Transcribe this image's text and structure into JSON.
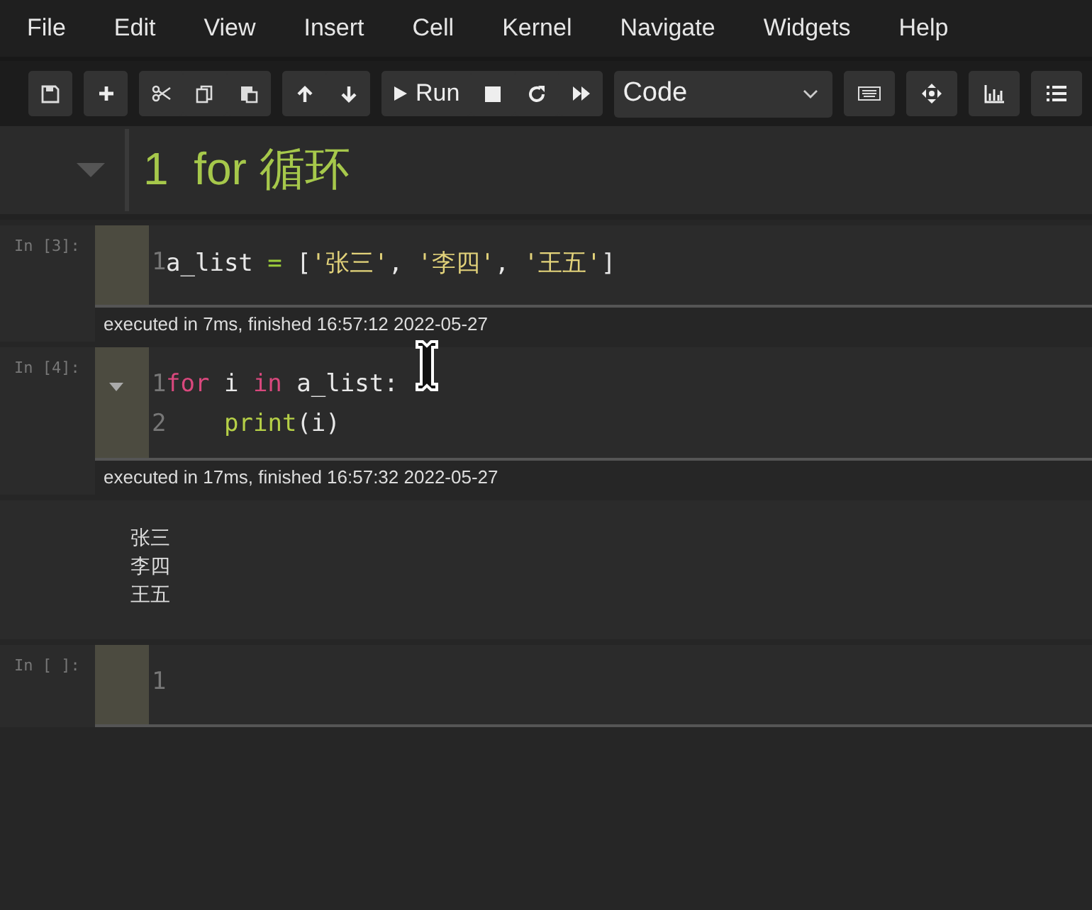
{
  "menu": [
    "File",
    "Edit",
    "View",
    "Insert",
    "Cell",
    "Kernel",
    "Navigate",
    "Widgets",
    "Help"
  ],
  "toolbar": {
    "run_label": "Run",
    "cell_type": "Code"
  },
  "heading": {
    "number": "1",
    "text": "for 循环",
    "expanded": true
  },
  "cells": [
    {
      "prompt": "In [3]:",
      "collapsible": false,
      "lines": [
        {
          "number": "1",
          "indented": false,
          "tokens": [
            {
              "kind": "name",
              "text": "a_list "
            },
            {
              "kind": "operator",
              "text": "="
            },
            {
              "kind": "name",
              "text": " ["
            },
            {
              "kind": "string",
              "text": "'张三'"
            },
            {
              "kind": "name",
              "text": ", "
            },
            {
              "kind": "string",
              "text": "'李四'"
            },
            {
              "kind": "name",
              "text": ", "
            },
            {
              "kind": "string",
              "text": "'王五'"
            },
            {
              "kind": "name",
              "text": "]"
            }
          ]
        }
      ],
      "note": "executed in 7ms, finished 16:57:12 2022-05-27"
    },
    {
      "prompt": "In [4]:",
      "collapsible": true,
      "lines": [
        {
          "number": "1",
          "indented": false,
          "tokens": [
            {
              "kind": "keyword",
              "text": "for"
            },
            {
              "kind": "name",
              "text": " i "
            },
            {
              "kind": "keyword",
              "text": "in"
            },
            {
              "kind": "name",
              "text": " a_list:"
            }
          ]
        },
        {
          "number": "2",
          "indented": true,
          "tokens": [
            {
              "kind": "builtin",
              "text": "print"
            },
            {
              "kind": "name",
              "text": "(i)"
            }
          ]
        }
      ],
      "note": "executed in 17ms, finished 16:57:32 2022-05-27",
      "output": [
        "张三",
        "李四",
        "王五"
      ]
    },
    {
      "prompt": "In [ ]:",
      "collapsible": false,
      "lines": [
        {
          "number": "1"
        }
      ]
    }
  ]
}
